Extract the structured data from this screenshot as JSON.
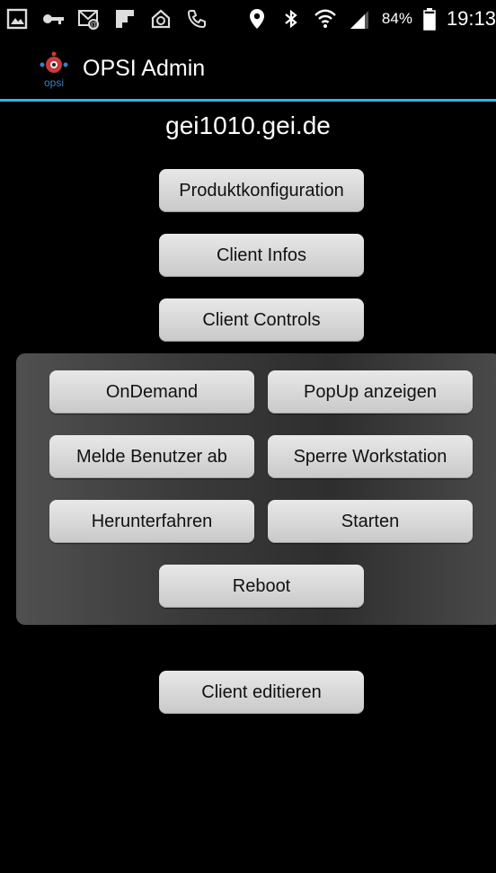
{
  "status_bar": {
    "icons_left": [
      "gallery-icon",
      "key-icon",
      "voicemail-icon",
      "flipboard-icon",
      "home-sync-icon",
      "phone-icon"
    ],
    "icons_right": [
      "location-icon",
      "bluetooth-icon",
      "wifi-icon",
      "signal-icon"
    ],
    "battery_percent": "84%",
    "battery_level": 0.84,
    "time": "19:13"
  },
  "action_bar": {
    "logo_icon": "opsi-logo-icon",
    "title": "OPSI Admin",
    "accent_color": "#33b5e5"
  },
  "host": "gei1010.gei.de",
  "buttons": {
    "product_config": "Produktkonfiguration",
    "client_infos": "Client Infos",
    "client_controls": "Client Controls",
    "ondemand": "OnDemand",
    "popup": "PopUp anzeigen",
    "logout_user": "Melde Benutzer ab",
    "lock_workstation": "Sperre Workstation",
    "shutdown": "Herunterfahren",
    "start": "Starten",
    "reboot": "Reboot",
    "edit_client": "Client editieren"
  }
}
